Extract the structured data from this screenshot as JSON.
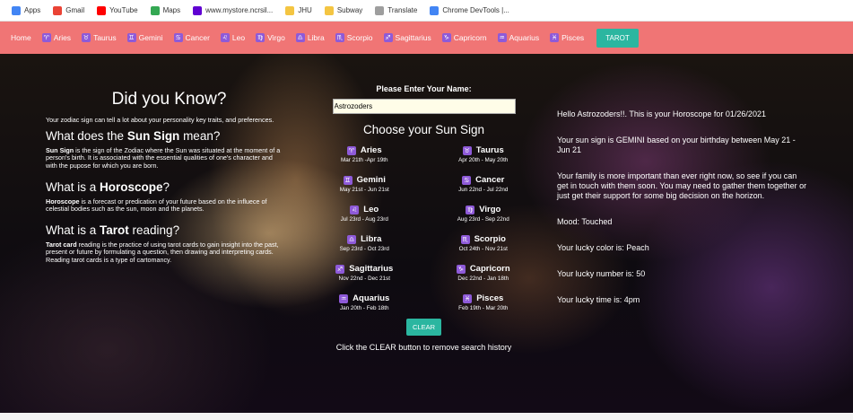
{
  "bookmarks": [
    {
      "label": "Apps",
      "icon": "apps-grid-icon",
      "color": "#4285f4"
    },
    {
      "label": "Gmail",
      "icon": "gmail-icon",
      "color": "#ea4335"
    },
    {
      "label": "YouTube",
      "icon": "youtube-icon",
      "color": "#ff0000"
    },
    {
      "label": "Maps",
      "icon": "maps-icon",
      "color": "#34a853"
    },
    {
      "label": "www.mystore.ncrsil...",
      "icon": "yahoo-icon",
      "color": "#6001d2"
    },
    {
      "label": "JHU",
      "icon": "folder-icon",
      "color": "#f4c542"
    },
    {
      "label": "Subway",
      "icon": "folder-icon",
      "color": "#f4c542"
    },
    {
      "label": "Translate",
      "icon": "globe-icon",
      "color": "#9e9e9e"
    },
    {
      "label": "Chrome DevTools |...",
      "icon": "chrome-icon",
      "color": "#4285f4"
    }
  ],
  "nav": {
    "home": "Home",
    "signs": [
      {
        "label": "Aries",
        "glyph": "♈"
      },
      {
        "label": "Taurus",
        "glyph": "♉"
      },
      {
        "label": "Gemini",
        "glyph": "♊"
      },
      {
        "label": "Cancer",
        "glyph": "♋"
      },
      {
        "label": "Leo",
        "glyph": "♌"
      },
      {
        "label": "Virgo",
        "glyph": "♍"
      },
      {
        "label": "Libra",
        "glyph": "♎"
      },
      {
        "label": "Scorpio",
        "glyph": "♏"
      },
      {
        "label": "Sagittarius",
        "glyph": "♐"
      },
      {
        "label": "Capricorn",
        "glyph": "♑"
      },
      {
        "label": "Aquarius",
        "glyph": "♒"
      },
      {
        "label": "Pisces",
        "glyph": "♓"
      }
    ],
    "tarot": "TAROT",
    "bar_color": "#f07575",
    "accent_color": "#2bb6a0"
  },
  "left": {
    "title": "Did you Know?",
    "intro": "Your zodiac sign can tell a lot about your personality key traits, and preferences.",
    "sun_q_pre": "What does the ",
    "sun_q_bold": "Sun Sign",
    "sun_q_post": " mean?",
    "sun_p_bold": "Sun Sign",
    "sun_p_rest": " is the sign of the Zodiac where the Sun was situated at the moment of a person's birth. It is associated with the essential qualities of one's character and with the pupose for which you are born.",
    "horo_q_pre": "What is a ",
    "horo_q_bold": "Horoscope",
    "horo_q_post": "?",
    "horo_p_bold": "Horoscope",
    "horo_p_rest": " is a forecast or predication of your future based on the influece of celestial bodies such as the sun, moon and the planets.",
    "tarot_q_pre": "What is a ",
    "tarot_q_bold": "Tarot",
    "tarot_q_post": " reading?",
    "tarot_p_bold": "Tarot card",
    "tarot_p_rest": " reading is the practice of using tarot cards to gain insight into the past, present or future by formulating a question, then drawing and interpreting cards. Reading tarot cards is a type of cartomancy."
  },
  "center": {
    "enter_label": "Please Enter Your Name:",
    "name_value": "Astrozoders",
    "choose_title": "Choose your Sun Sign",
    "signs": [
      {
        "name": "Aries",
        "glyph": "♈",
        "dates": "Mar 21th -Apr 19th"
      },
      {
        "name": "Taurus",
        "glyph": "♉",
        "dates": "Apr 20th - May 20th"
      },
      {
        "name": "Gemini",
        "glyph": "♊",
        "dates": "May 21st - Jun 21st"
      },
      {
        "name": "Cancer",
        "glyph": "♋",
        "dates": "Jun 22nd - Jul 22nd"
      },
      {
        "name": "Leo",
        "glyph": "♌",
        "dates": "Jul 23rd - Aug 23rd"
      },
      {
        "name": "Virgo",
        "glyph": "♍",
        "dates": "Aug 23rd - Sep 22nd"
      },
      {
        "name": "Libra",
        "glyph": "♎",
        "dates": "Sep 23rd - Oct 23rd"
      },
      {
        "name": "Scorpio",
        "glyph": "♏",
        "dates": "Oct 24th - Nov 21st"
      },
      {
        "name": "Sagittarius",
        "glyph": "♐",
        "dates": "Nov 22nd - Dec 21st"
      },
      {
        "name": "Capricorn",
        "glyph": "♑",
        "dates": "Dec 22nd - Jan 18th"
      },
      {
        "name": "Aquarius",
        "glyph": "♒",
        "dates": "Jan 20th - Feb 18th"
      },
      {
        "name": "Pisces",
        "glyph": "♓",
        "dates": "Feb 19th - Mar 20th"
      }
    ],
    "clear_label": "CLEAR",
    "clear_note": "Click the CLEAR button to remove search history"
  },
  "right": {
    "greeting": "Hello Astrozoders!!. This is your Horoscope for 01/26/2021",
    "sun_sign": "Your sun sign is GEMINI based on your birthday between May 21 - Jun 21",
    "forecast": "Your family is more important than ever right now, so see if you can get in touch with them soon. You may need to gather them together or just get their support for some big decision on the horizon.",
    "mood": "Mood: Touched",
    "color": "Your lucky color is: Peach",
    "number": "Your lucky number is: 50",
    "time": "Your lucky time is: 4pm"
  }
}
